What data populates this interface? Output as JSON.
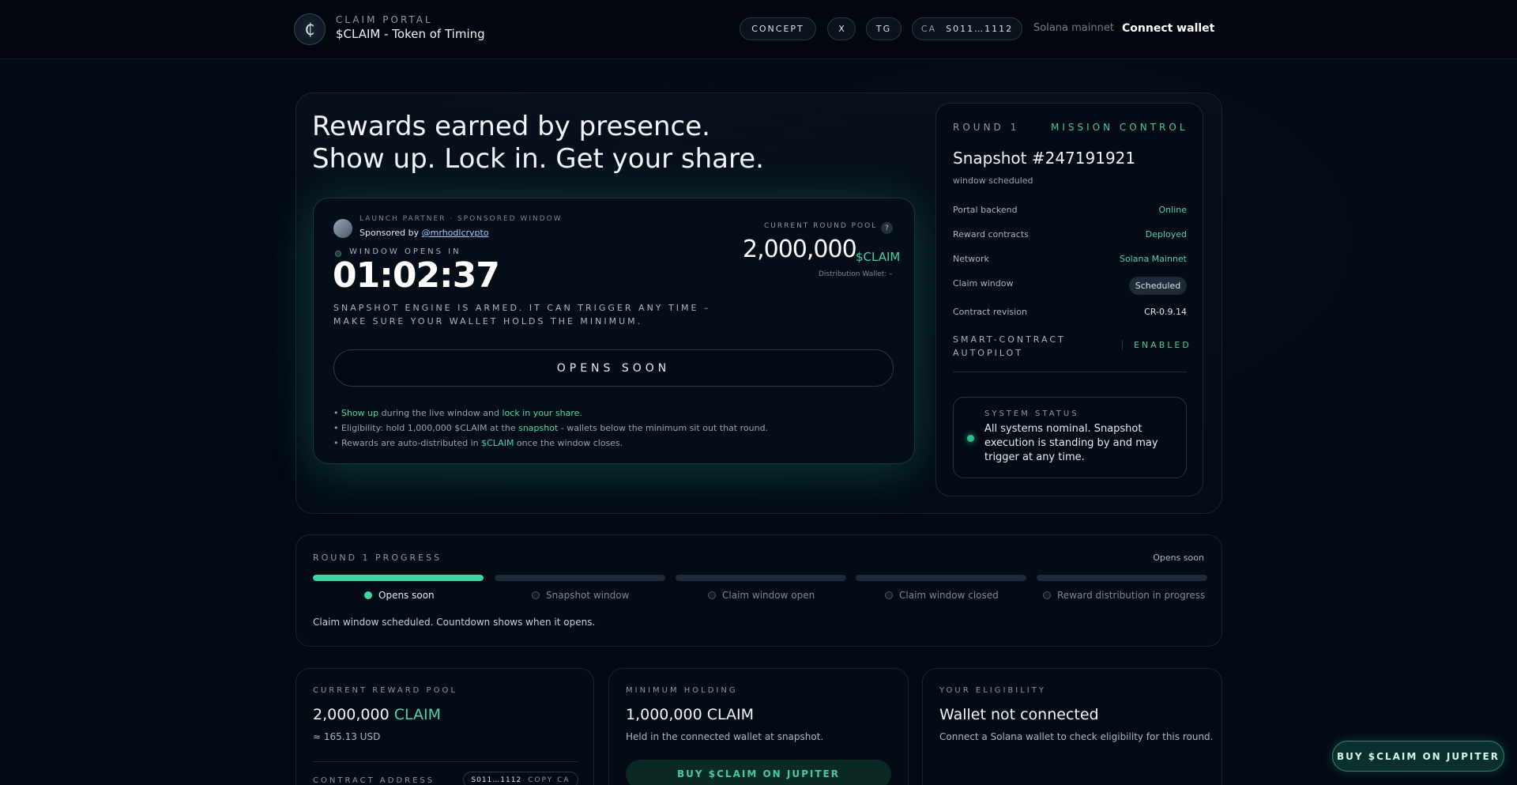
{
  "header": {
    "logo_glyph": "₵",
    "brand_sub": "CLAIM PORTAL",
    "brand_title": "$CLAIM - Token of Timing",
    "nav": [
      "CONCEPT",
      "X",
      "TG"
    ],
    "ca_label": "CA",
    "ca_value": "S011…1112",
    "network": "Solana mainnet",
    "connect": "Connect wallet"
  },
  "hero": {
    "headline_1": "Rewards earned by presence.",
    "headline_2": "Show up. Lock in. Get your share."
  },
  "schedule": {
    "partner_label": "LAUNCH PARTNER · SPONSORED WINDOW",
    "sponsored_by": "Sponsored by ",
    "sponsor_handle": "@mrhodlcrypto",
    "window_label": "WINDOW OPENS IN",
    "countdown": "01:02:37",
    "armed_text": "SNAPSHOT ENGINE IS ARMED. IT CAN TRIGGER ANY TIME – MAKE SURE YOUR WALLET HOLDS THE MINIMUM.",
    "pool_label": "CURRENT ROUND POOL",
    "help": "?",
    "pool_amount": "2,000,000",
    "pool_unit": "$CLAIM",
    "dist_wallet": "Distribution Wallet: –",
    "button": "OPENS SOON",
    "bullet1": {
      "a": "Show up",
      "b": " during the live window and ",
      "c": "lock in your share."
    },
    "bullet2": {
      "a": "Eligibility: hold 1,000,000 $CLAIM at the ",
      "b": "snapshot",
      "c": " - wallets below the minimum sit out that round."
    },
    "bullet3": {
      "a": "Rewards are auto-distributed in ",
      "b": "$CLAIM",
      "c": " once the window closes."
    }
  },
  "mission": {
    "round": "ROUND 1",
    "title": "MISSION CONTROL",
    "snapshot": "Snapshot #247191921",
    "snapshot_state": "window scheduled",
    "rows": [
      {
        "label": "Portal backend",
        "value": "Online"
      },
      {
        "label": "Reward contracts",
        "value": "Deployed"
      },
      {
        "label": "Network",
        "value": "Solana Mainnet"
      },
      {
        "label": "Claim window",
        "value": "Scheduled"
      },
      {
        "label": "Contract revision",
        "value": "CR-0.9.14"
      }
    ],
    "autopilot_1": "SMART-CONTRACT",
    "autopilot_2": "AUTOPILOT",
    "autopilot_value": "ENABLED",
    "status_label": "SYSTEM STATUS",
    "status_text": "All systems nominal. Snapshot execution is standing by and may trigger at any time."
  },
  "progress": {
    "title": "ROUND 1 PROGRESS",
    "state": "Opens soon",
    "steps": [
      "Opens soon",
      "Snapshot window",
      "Claim window open",
      "Claim window closed",
      "Reward distribution in progress"
    ],
    "fill": [
      1,
      0,
      0,
      0,
      0
    ],
    "note": "Claim window scheduled. Countdown shows when it opens."
  },
  "cards": {
    "pool_label": "CURRENT REWARD POOL",
    "pool_amount": "2,000,000",
    "pool_unit": "CLAIM",
    "pool_usd": "≈ 165.13 USD",
    "ca_label": "CONTRACT ADDRESS",
    "ca_value": "S011…1112",
    "copy": "COPY CA",
    "min_label": "MINIMUM HOLDING",
    "min_amount": "1,000,000 CLAIM",
    "min_sub": "Held in the connected wallet at snapshot.",
    "buy_inline": "BUY $CLAIM ON JUPITER",
    "elig_label": "YOUR ELIGIBILITY",
    "elig_status": "Wallet not connected",
    "elig_sub": "Connect a Solana wallet to check eligibility for this round."
  },
  "float_buy": "BUY $CLAIM ON JUPITER",
  "colors": {
    "accent": "#3ed6a4",
    "bg": "#030a14"
  }
}
